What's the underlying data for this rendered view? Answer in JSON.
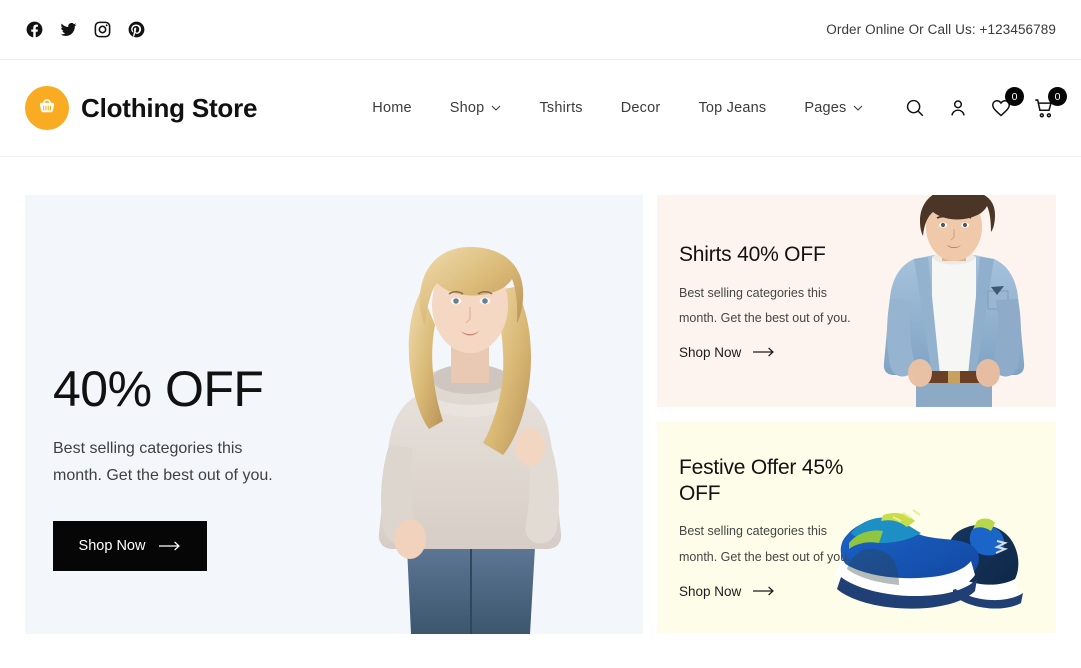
{
  "topbar": {
    "social": [
      {
        "name": "facebook-icon",
        "label": "Facebook"
      },
      {
        "name": "twitter-icon",
        "label": "Twitter"
      },
      {
        "name": "instagram-icon",
        "label": "Instagram"
      },
      {
        "name": "pinterest-icon",
        "label": "Pinterest"
      }
    ],
    "contact": "Order Online Or Call Us: +123456789"
  },
  "header": {
    "brand_name": "Clothing Store",
    "brand_icon": "shopping-basket-icon",
    "brand_color": "#f9ac22",
    "nav": [
      {
        "label": "Home",
        "dropdown": false
      },
      {
        "label": "Shop",
        "dropdown": true
      },
      {
        "label": "Tshirts",
        "dropdown": false
      },
      {
        "label": "Decor",
        "dropdown": false
      },
      {
        "label": "Top Jeans",
        "dropdown": false
      },
      {
        "label": "Pages",
        "dropdown": true
      }
    ],
    "actions": {
      "search_icon": "search-icon",
      "account_icon": "user-icon",
      "wishlist_icon": "heart-icon",
      "wishlist_count": "0",
      "cart_icon": "cart-icon",
      "cart_count": "0",
      "badge_color": "#060606"
    }
  },
  "hero": {
    "title": "40% OFF",
    "subtitle": "Best selling categories this month. Get the best out of you.",
    "button_label": "Shop Now",
    "background": "#f3f7fc",
    "image_alt": "woman-in-beige-cowl-neck-sweater"
  },
  "promos": [
    {
      "title": "Shirts 40% OFF",
      "subtitle": "Best selling categories this month. Get the best out of you.",
      "link_label": "Shop Now",
      "background": "#fdf4ef",
      "image_alt": "man-in-denim-jacket"
    },
    {
      "title": "Festive Offer 45% OFF",
      "subtitle": "Best selling categories this month. Get the best out of you.",
      "link_label": "Shop Now",
      "background": "#fdfde9",
      "image_alt": "blue-green-running-shoes"
    }
  ]
}
